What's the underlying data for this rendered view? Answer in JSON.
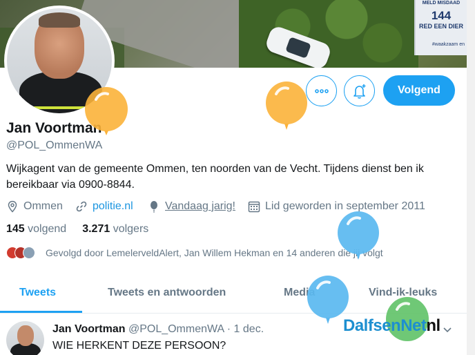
{
  "banner": {
    "sign_line1": "MELD MISDAAD",
    "sign_number": "144",
    "sign_line3": "RED EEN DIER",
    "sign_footer": "#waakzaam en"
  },
  "profile": {
    "name": "Jan Voortman",
    "handle": "@POL_OmmenWA",
    "bio": "Wijkagent van de  gemeente Ommen, ten noorden van de Vecht. Tijdens dienst ben ik bereikbaar via 0900-8844.",
    "location": "Ommen",
    "website": "politie.nl",
    "birthday": "Vandaag jarig!",
    "joined": "Lid geworden in september 2011",
    "following_count": "145",
    "following_label": "volgend",
    "followers_count": "3.271",
    "followers_label": "volgers",
    "followed_by": "Gevolgd door LemelerveldAlert, Jan Willem Hekman en 14 anderen die jij volgt"
  },
  "actions": {
    "follow_label": "Volgend",
    "more_icon": "more-dots-icon",
    "notify_icon": "bell-plus-icon"
  },
  "tabs": [
    {
      "label": "Tweets",
      "active": true
    },
    {
      "label": "Tweets en antwoorden",
      "active": false
    },
    {
      "label": "Media",
      "active": false
    },
    {
      "label": "Vind-ik-leuks",
      "active": false
    }
  ],
  "tweet": {
    "name": "Jan Voortman",
    "handle": "@POL_OmmenWA",
    "separator": "·",
    "date": "1 dec.",
    "text": "WIE HERKENT DEZE PERSOON?"
  },
  "watermark": {
    "part1": "DalfsenNet",
    "part2": "nl"
  },
  "colors": {
    "accent": "#1da1f2",
    "secondary_text": "#657786",
    "primary_text": "#14171a",
    "balloon_orange": "#fbb23a",
    "balloon_blue": "#5ab8f0",
    "balloon_green": "#63c36a"
  }
}
